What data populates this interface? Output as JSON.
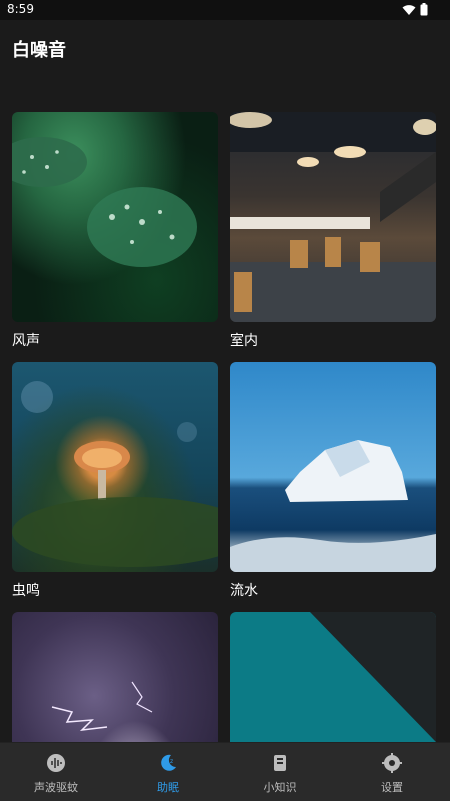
{
  "status": {
    "time": "8:59",
    "wifi_icon": "wifi-icon",
    "battery_icon": "battery-icon"
  },
  "app": {
    "title": "白噪音"
  },
  "cards": [
    {
      "label": "风声"
    },
    {
      "label": "室内"
    },
    {
      "label": "虫鸣"
    },
    {
      "label": "流水"
    },
    {
      "label": ""
    },
    {
      "label": ""
    }
  ],
  "nav": {
    "items": [
      {
        "label": "声波驱蚊",
        "icon": "sound-wave-icon"
      },
      {
        "label": "助眠",
        "icon": "moon-sleep-icon"
      },
      {
        "label": "小知识",
        "icon": "book-icon"
      },
      {
        "label": "设置",
        "icon": "gear-icon"
      }
    ],
    "active_color": "#2f9be8"
  }
}
